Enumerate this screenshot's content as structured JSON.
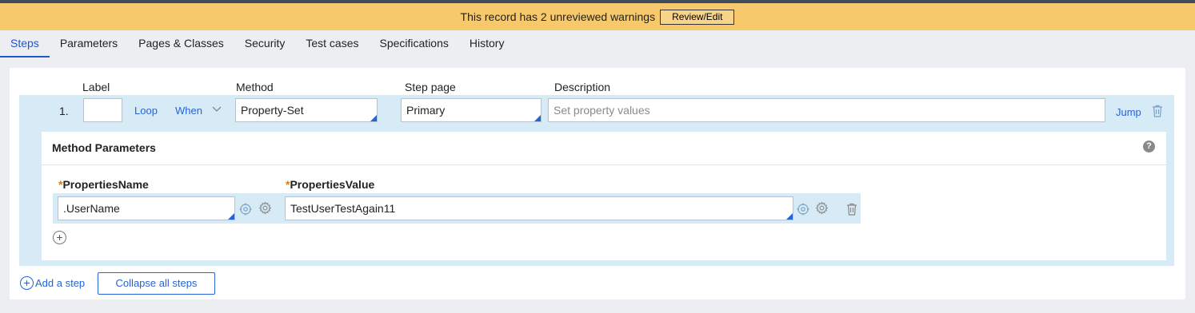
{
  "warning": {
    "message": "This record has 2 unreviewed warnings",
    "button_label": "Review/Edit"
  },
  "tabs": [
    {
      "label": "Steps",
      "active": true
    },
    {
      "label": "Parameters"
    },
    {
      "label": "Pages & Classes"
    },
    {
      "label": "Security"
    },
    {
      "label": "Test cases"
    },
    {
      "label": "Specifications"
    },
    {
      "label": "History"
    }
  ],
  "columns": {
    "label": "Label",
    "method": "Method",
    "step_page": "Step page",
    "description": "Description"
  },
  "step": {
    "number": "1.",
    "label_value": "",
    "loop": "Loop",
    "when": "When",
    "method": "Property-Set",
    "step_page": "Primary",
    "description_placeholder": "Set property values",
    "jump": "Jump"
  },
  "method_parameters": {
    "title": "Method Parameters",
    "help": "?",
    "required_marker": "*",
    "name_header": "PropertiesName",
    "value_header": "PropertiesValue",
    "rows": [
      {
        "name": ".UserName",
        "value": "TestUserTestAgain11"
      }
    ],
    "add": "+"
  },
  "footer": {
    "add_step_icon": "+",
    "add_step": "Add a step",
    "collapse_all": "Collapse all steps"
  },
  "colors": {
    "accent": "#2663d6",
    "warning_bg": "#f5c96c",
    "row_bg": "#d6ebf6",
    "required": "#d97a1e"
  }
}
